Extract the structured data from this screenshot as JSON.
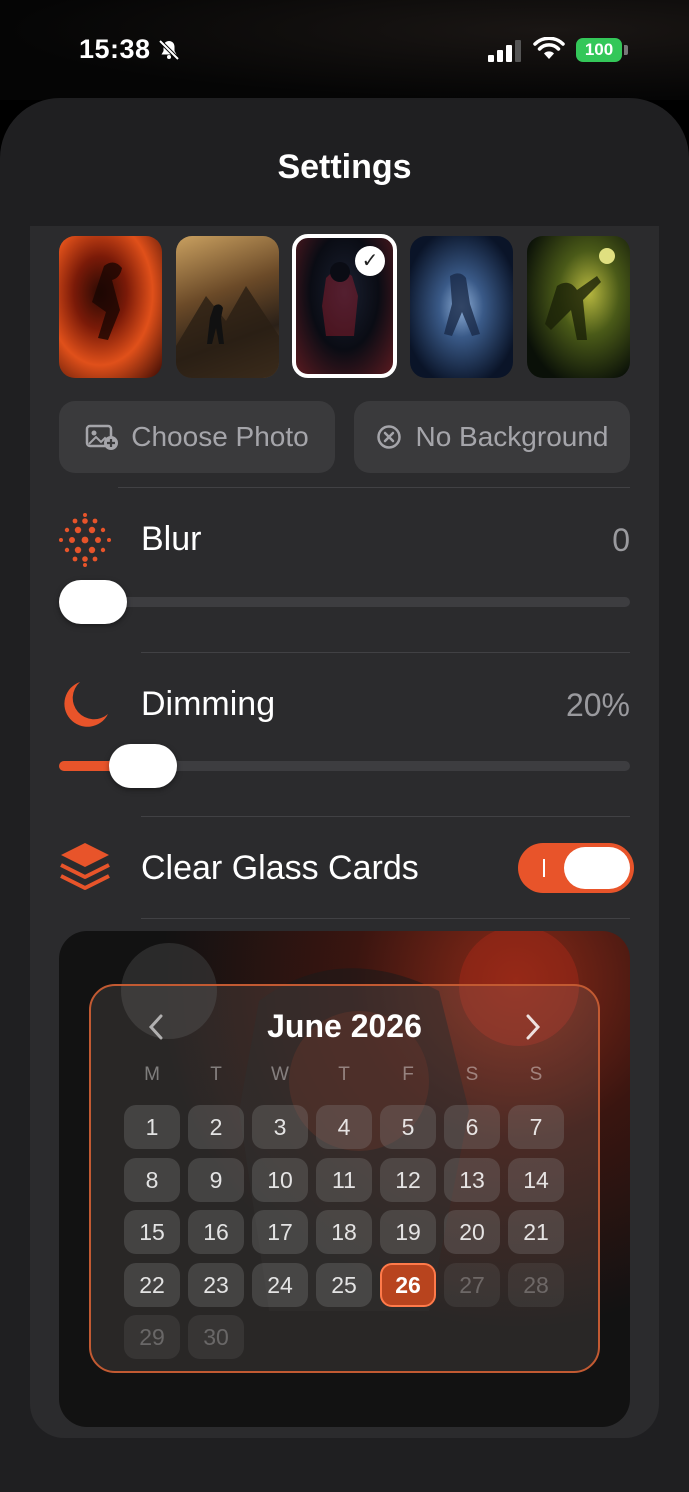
{
  "status": {
    "time": "15:38",
    "battery": "100"
  },
  "title": "Settings",
  "backgrounds": {
    "selected_index": 2
  },
  "buttons": {
    "choose_photo": "Choose Photo",
    "no_background": "No Background"
  },
  "blur": {
    "label": "Blur",
    "value": "0",
    "level": 0
  },
  "dimming": {
    "label": "Dimming",
    "value": "20%",
    "level": 0.2
  },
  "glass": {
    "label": "Clear Glass Cards",
    "enabled": true
  },
  "calendar": {
    "month": "June 2026",
    "weekdays": [
      "M",
      "T",
      "W",
      "T",
      "F",
      "S",
      "S"
    ],
    "days": [
      "1",
      "2",
      "3",
      "4",
      "5",
      "6",
      "7",
      "8",
      "9",
      "10",
      "11",
      "12",
      "13",
      "14",
      "15",
      "16",
      "17",
      "18",
      "19",
      "20",
      "21",
      "22",
      "23",
      "24",
      "25",
      "26",
      "27",
      "28",
      "29",
      "30"
    ],
    "today": "26"
  },
  "colors": {
    "accent": "#e8542a",
    "sheet": "#1f1f21",
    "card": "#2b2b2d"
  }
}
